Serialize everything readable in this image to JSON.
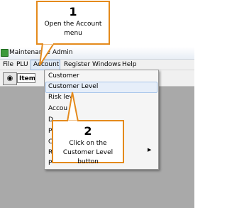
{
  "window": {
    "title": "Maintenance Admin"
  },
  "menubar": {
    "items": [
      {
        "label": "File"
      },
      {
        "label": "PLU"
      },
      {
        "label": "Account"
      },
      {
        "label": "Register"
      },
      {
        "label": "Windows"
      },
      {
        "label": "Help"
      }
    ],
    "active": "Account"
  },
  "toolbar": {
    "field_label": "Item"
  },
  "account_menu": {
    "items": [
      {
        "label": "Customer"
      },
      {
        "label": "Customer Level",
        "highlighted": true
      },
      {
        "label": "Risk lev"
      },
      {
        "label": "Accou     w"
      },
      {
        "label": "D"
      },
      {
        "label": "P"
      },
      {
        "label": "C"
      },
      {
        "label": "R"
      },
      {
        "label": "P"
      }
    ]
  },
  "callouts": [
    {
      "number": "1",
      "text": "Open the Account menu"
    },
    {
      "number": "2",
      "text": "Click on the Customer Level button"
    }
  ],
  "colors": {
    "callout_border": "#e48a1c",
    "highlight": "#e6eef9"
  }
}
